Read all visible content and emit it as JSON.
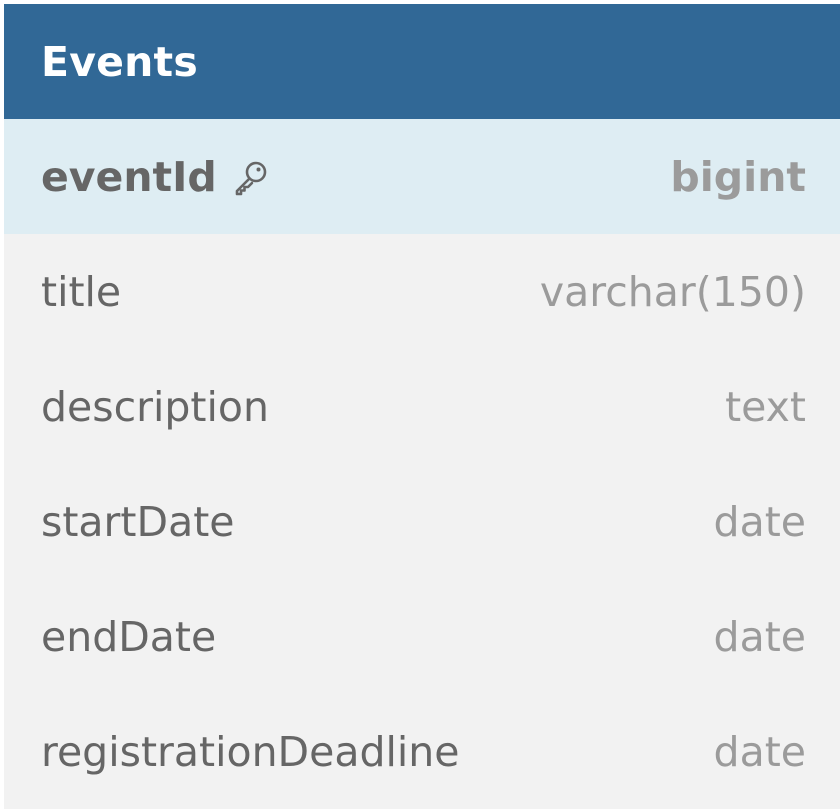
{
  "table": {
    "name": "Events",
    "fields": [
      {
        "name": "eventId",
        "type": "bigint",
        "primary_key": true,
        "icon": "key-icon"
      },
      {
        "name": "title",
        "type": "varchar(150)",
        "primary_key": false
      },
      {
        "name": "description",
        "type": "text",
        "primary_key": false
      },
      {
        "name": "startDate",
        "type": "date",
        "primary_key": false
      },
      {
        "name": "endDate",
        "type": "date",
        "primary_key": false
      },
      {
        "name": "registrationDeadline",
        "type": "date",
        "primary_key": false
      }
    ]
  },
  "colors": {
    "header_bg": "#316896",
    "pk_row_bg": "#deedf3",
    "row_bg": "#f2f2f2",
    "name_text": "#666666",
    "type_text": "#9b9b9b"
  }
}
